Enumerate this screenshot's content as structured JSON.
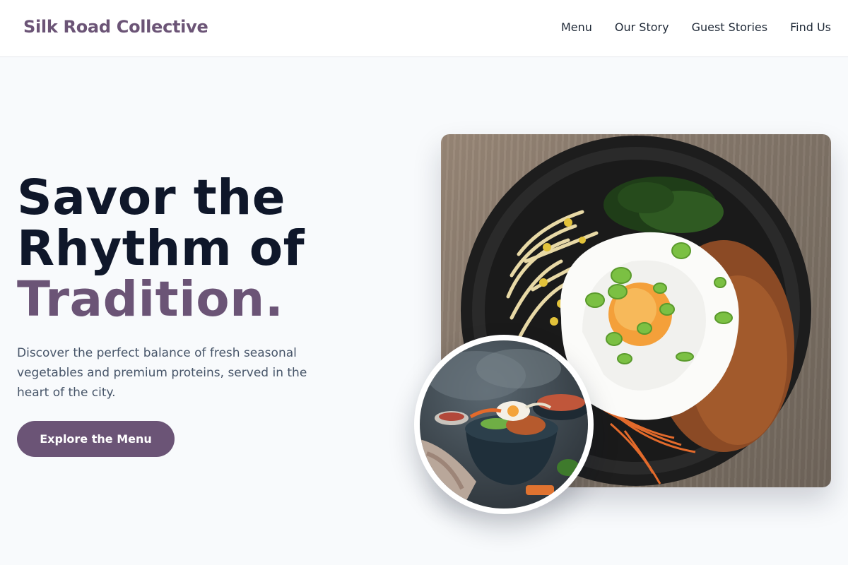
{
  "header": {
    "brand": "Silk Road Collective",
    "nav": [
      "Menu",
      "Our Story",
      "Guest Stories",
      "Find Us"
    ]
  },
  "hero": {
    "headline_line1": "Savor the",
    "headline_line2": "Rhythm of",
    "headline_accent": "Tradition.",
    "lede": "Discover the perfect balance of fresh seasonal vegetables and premium proteins, served in the heart of the city.",
    "cta_label": "Explore the Menu"
  },
  "images": {
    "main": "bibimbap-bowl-image",
    "inset": "rice-bowl-table-image"
  },
  "colors": {
    "accent": "#6b5476",
    "headline": "#0f172a",
    "body_text": "#475569",
    "background": "#f8fafc"
  }
}
